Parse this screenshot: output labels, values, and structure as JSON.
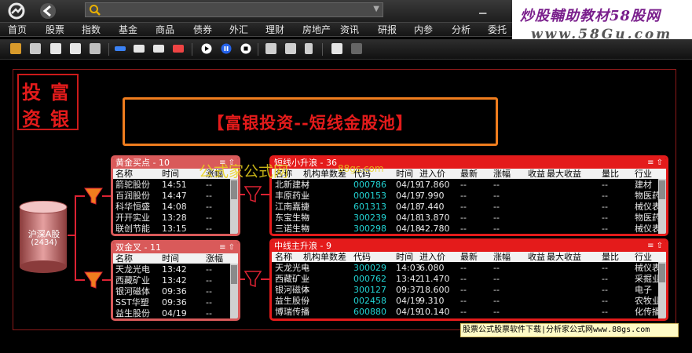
{
  "search": {
    "placeholder": ""
  },
  "brand": {
    "line1": "炒股輔助教材58股网",
    "line2": "www.58Gu.com"
  },
  "menu": [
    "首页",
    "股票",
    "指数",
    "基金",
    "商品",
    "债券",
    "外汇",
    "理财",
    "房地产",
    "资讯",
    "研报",
    "内参",
    "分析",
    "委托"
  ],
  "logo_text": [
    "投",
    "富",
    "资",
    "银"
  ],
  "title": "【富银投资--短线金股池】",
  "source": {
    "label": "沪深A股",
    "count": "(2434)"
  },
  "watermark": "公式家公式网",
  "watermark2": "88gs.com",
  "panels": {
    "buy": {
      "title": "黄金买点 - 10",
      "cols": [
        "名称",
        "时间",
        "涨幅"
      ],
      "rows": [
        [
          "箭驼股份",
          "14:51",
          "--"
        ],
        [
          "百润股份",
          "14:47",
          "--"
        ],
        [
          "科华恒盛",
          "14:08",
          "--"
        ],
        [
          "开开实业",
          "13:28",
          "--"
        ],
        [
          "联创节能",
          "13:15",
          "--"
        ]
      ]
    },
    "cross": {
      "title": "双金叉 - 11",
      "cols": [
        "名称",
        "时间",
        "涨幅"
      ],
      "rows": [
        [
          "天龙光电",
          "13:42",
          "--"
        ],
        [
          "西藏矿业",
          "13:42",
          "--"
        ],
        [
          "银河磁体",
          "09:36",
          "--"
        ],
        [
          "SST华塑",
          "09:36",
          "--"
        ],
        [
          "益生股份",
          "04/19",
          "--"
        ]
      ]
    },
    "short": {
      "title": "短线小升浪 - 36",
      "cols": [
        "名称",
        "机构单数差",
        "代码",
        "时间",
        "进入价",
        "最新",
        "涨幅",
        "收益",
        "最大收益",
        "量比",
        "行业"
      ],
      "rows": [
        [
          "北新建材",
          "--",
          "000786",
          "04/19",
          "17.860",
          "--",
          "--",
          "",
          "",
          "--",
          "建材"
        ],
        [
          "丰原药业",
          "--",
          "000153",
          "04/19",
          "7.990",
          "--",
          "--",
          "",
          "",
          "--",
          "物医药"
        ],
        [
          "江南嘉捷",
          "--",
          "601313",
          "04/18",
          "7.440",
          "--",
          "--",
          "",
          "",
          "--",
          "械仪表"
        ],
        [
          "东宝生物",
          "--",
          "300239",
          "04/18",
          "13.870",
          "--",
          "--",
          "",
          "",
          "--",
          "物医药"
        ],
        [
          "三诺生物",
          "--",
          "300298",
          "04/18",
          "42.780",
          "--",
          "--",
          "",
          "",
          "--",
          "械仪表"
        ]
      ]
    },
    "mid": {
      "title": "中线主升浪 - 9",
      "cols": [
        "名称",
        "机构单数差",
        "代码",
        "时间",
        "进入价",
        "最新",
        "涨幅",
        "收益",
        "最大收益",
        "量比",
        "行业"
      ],
      "rows": [
        [
          "天龙光电",
          "--",
          "300029",
          "14:03",
          "6.080",
          "--",
          "--",
          "",
          "",
          "--",
          "械仪表"
        ],
        [
          "西藏矿业",
          "--",
          "000762",
          "13:42",
          "11.470",
          "--",
          "--",
          "",
          "",
          "--",
          "采掘业"
        ],
        [
          "银河磁体",
          "--",
          "300127",
          "09:37",
          "18.600",
          "--",
          "--",
          "",
          "",
          "--",
          "电子"
        ],
        [
          "益生股份",
          "--",
          "002458",
          "04/19",
          "9.310",
          "--",
          "--",
          "",
          "",
          "--",
          "农牧业"
        ],
        [
          "博瑞传播",
          "--",
          "600880",
          "04/19",
          "10.140",
          "--",
          "--",
          "",
          "",
          "--",
          "化传播"
        ]
      ]
    }
  },
  "footer": "股票公式股票软件下载|分析家公式网www.88gs.com",
  "colors": {
    "accent_red": "#e41b1b",
    "panel_pink": "#d95a5a",
    "title_border": "#f07d1e",
    "code_cyan": "#22d3d3"
  }
}
